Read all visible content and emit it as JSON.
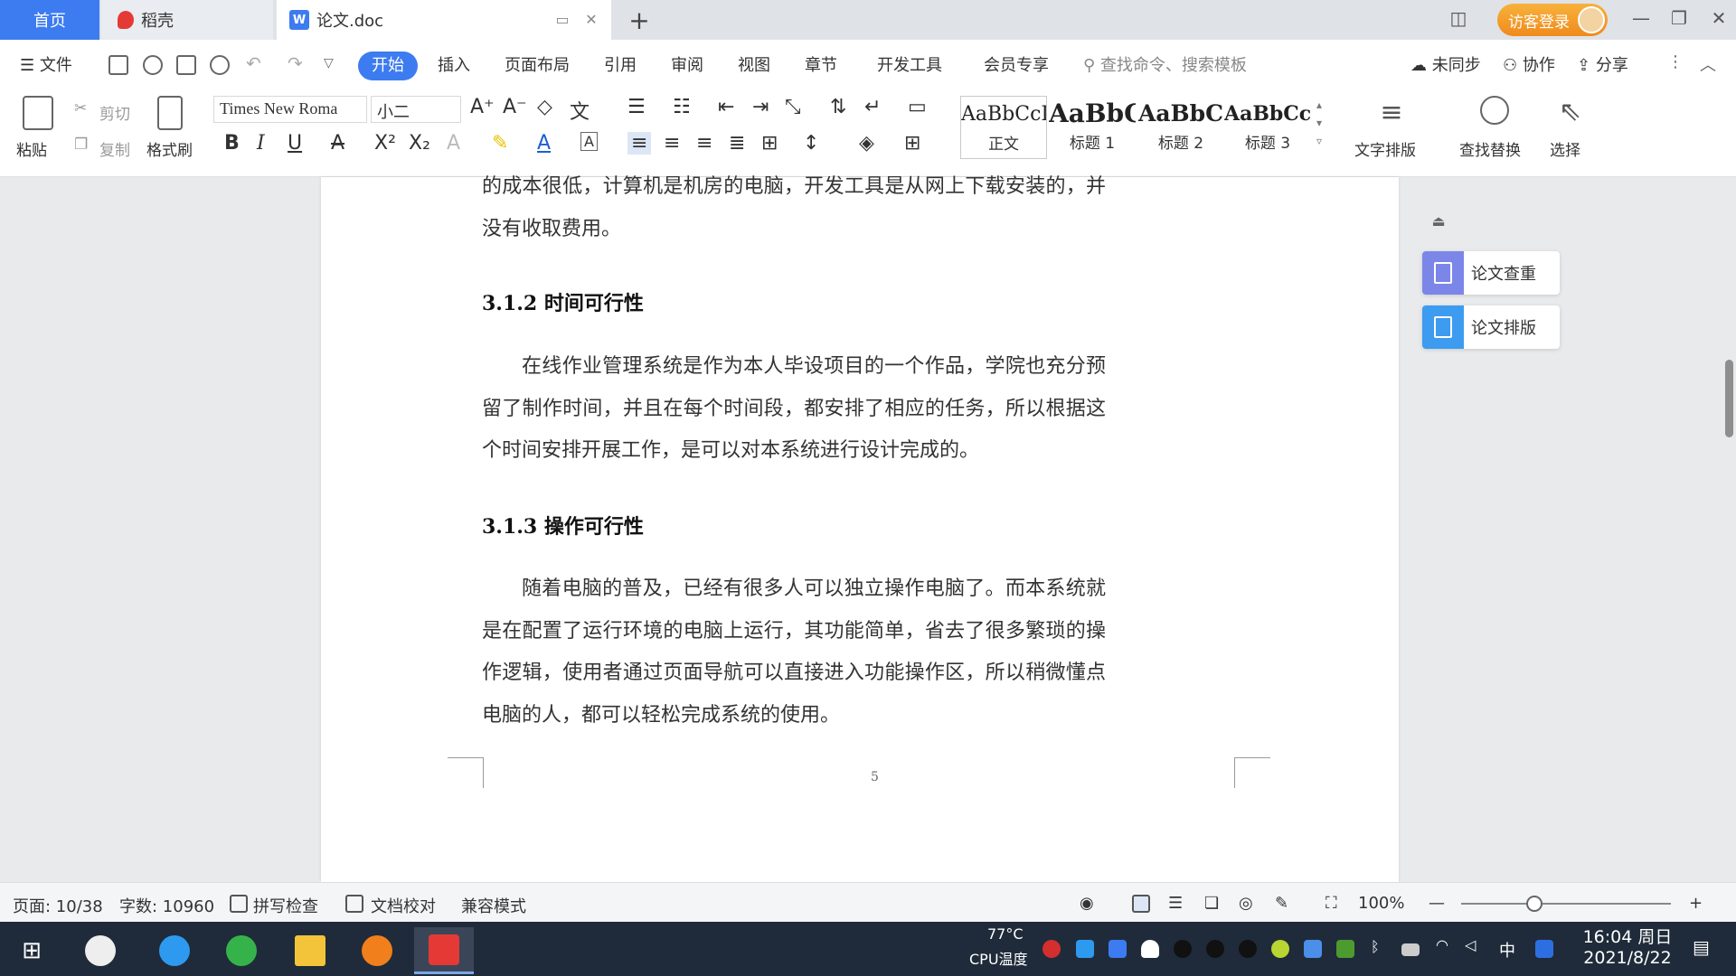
{
  "titlebar": {
    "tabs": [
      {
        "label": "首页"
      },
      {
        "label": "稻壳"
      },
      {
        "label": "论文.doc"
      }
    ],
    "login_label": "访客登录"
  },
  "menu": {
    "file_label": "文件",
    "items": [
      "开始",
      "插入",
      "页面布局",
      "引用",
      "审阅",
      "视图",
      "章节",
      "开发工具",
      "会员专享"
    ],
    "search_placeholder": "查找命令、搜索模板",
    "sync_label": "未同步",
    "collab_label": "协作",
    "share_label": "分享"
  },
  "ribbon": {
    "paste_label": "粘贴",
    "cut_label": "剪切",
    "copy_label": "复制",
    "format_painter_label": "格式刷",
    "font_name": "Times New Roma",
    "font_size": "小二",
    "styles": [
      {
        "sample": "AaBbCcI",
        "name": "正文"
      },
      {
        "sample": "AaBbC",
        "name": "标题 1"
      },
      {
        "sample": "AaBbC",
        "name": "标题 2"
      },
      {
        "sample": "AaBbCcl",
        "name": "标题 3"
      }
    ],
    "text_layout_label": "文字排版",
    "find_replace_label": "查找替换",
    "select_label": "选择"
  },
  "document": {
    "para_top": "的成本很低，计算机是机房的电脑，开发工具是从网上下载安装的，并没有收取费用。",
    "heading_1": "3.1.2 时间可行性",
    "para_time": "在线作业管理系统是作为本人毕设项目的一个作品，学院也充分预留了制作时间，并且在每个时间段，都安排了相应的任务，所以根据这个时间安排开展工作，是可以对本系统进行设计完成的。",
    "heading_2": "3.1.3 操作可行性",
    "para_operation": "随着电脑的普及，已经有很多人可以独立操作电脑了。而本系统就是在配置了运行环境的电脑上运行，其功能简单，省去了很多繁琐的操作逻辑，使用者通过页面导航可以直接进入功能操作区，所以稍微懂点电脑的人，都可以轻松完成系统的使用。",
    "page_number": "5"
  },
  "side_panel": {
    "items": [
      {
        "label": "论文查重",
        "color": "#7b86e8"
      },
      {
        "label": "论文排版",
        "color": "#3d9bf0"
      }
    ]
  },
  "statusbar": {
    "page": "页面: 10/38",
    "words": "字数: 10960",
    "spell_check": "拼写检查",
    "doc_proof": "文档校对",
    "compat_mode": "兼容模式",
    "zoom": "100%",
    "zoom_level": 0.35
  },
  "taskbar": {
    "temp": "77°C",
    "temp_label": "CPU温度",
    "ime": "中",
    "time": "16:04 周日",
    "date": "2021/8/22"
  },
  "colors": {
    "accent": "#3d7bf0",
    "login": "#f39a26",
    "taskbar": "#1f2b3a"
  }
}
